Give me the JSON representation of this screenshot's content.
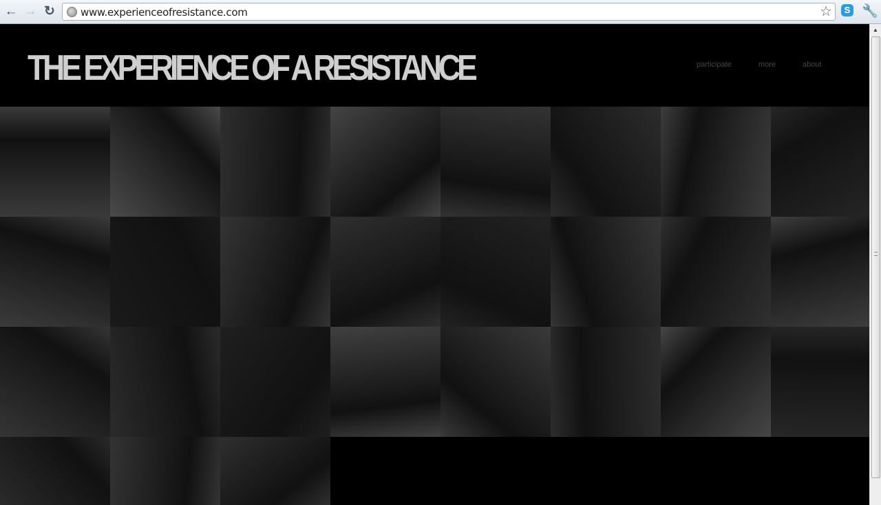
{
  "browser": {
    "url": "www.experienceofresistance.com",
    "back_icon": "←",
    "forward_icon": "→",
    "reload_icon": "↻",
    "star_icon": "☆",
    "extension_icon": "S",
    "wrench_icon": "🔧"
  },
  "site": {
    "logo": "THE EXPERIENCE OF A RESISTANCE",
    "nav": [
      {
        "label": "participate"
      },
      {
        "label": "more"
      },
      {
        "label": "about"
      }
    ]
  },
  "tiles": [
    "#3a3a3a",
    "#4a4a4a",
    "#2e2e2e",
    "#444",
    "#333",
    "#2c2c2c",
    "#3d3d3d",
    "#262626",
    "#3b3b3b",
    "#1a1a1a",
    "#343434",
    "#2f2f2f",
    "#222",
    "#363636",
    "#303030",
    "#3e3e3e",
    "#353535",
    "#2b2b2b",
    "#1f1f1f",
    "#404040",
    "#3a3a3a",
    "#2d2d2d",
    "#464646",
    "#262626",
    "#2a2a2a",
    "#333333",
    "#2f2f2f"
  ]
}
